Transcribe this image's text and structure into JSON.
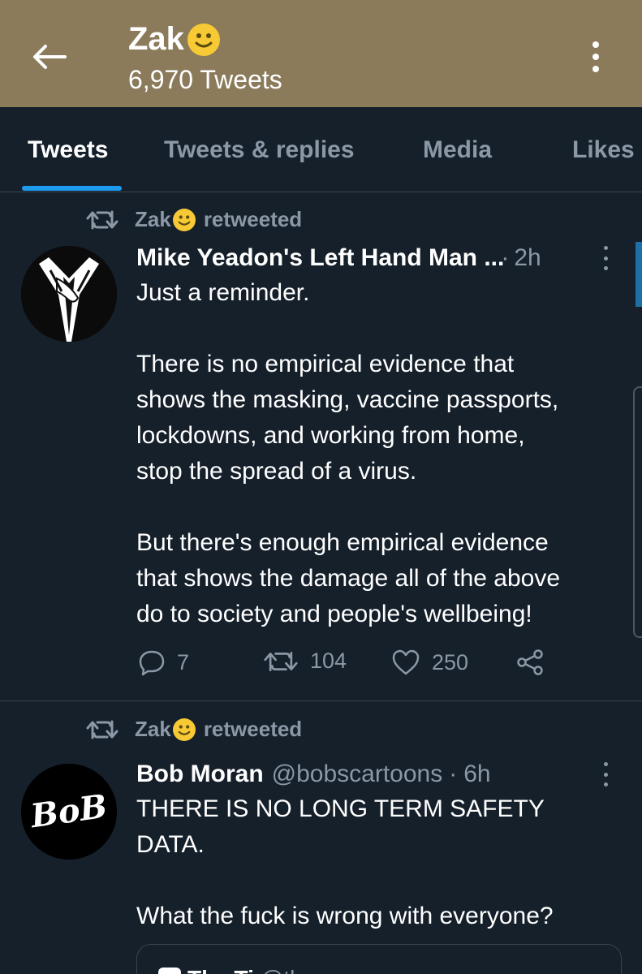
{
  "header": {
    "profile_name": "Zak",
    "tweet_count": "6,970 Tweets",
    "background": "#8b7b5b"
  },
  "tabs": [
    {
      "label": "Tweets",
      "active": true
    },
    {
      "label": "Tweets & replies",
      "active": false
    },
    {
      "label": "Media",
      "active": false
    },
    {
      "label": "Likes",
      "active": false
    }
  ],
  "colors": {
    "background": "#15202b",
    "accent": "#1d9bf0",
    "secondary_text": "#8b98a5",
    "divider": "#38444d"
  },
  "tweets": [
    {
      "retweeted_by": "Zak",
      "retweet_label": "retweeted",
      "author_name": "Mike Yeadon's Left Hand Man ...",
      "dot": "·",
      "time": "2h",
      "text": [
        "Just a reminder.",
        "",
        "There is no empirical evidence that",
        "shows the masking, vaccine passports,",
        "lockdowns, and working from home,",
        "stop the spread of a virus.",
        "",
        "But there's enough empirical evidence",
        "that shows the damage all of the above",
        "do to society and people's wellbeing!"
      ],
      "replies": "7",
      "retweets": "104",
      "likes": "250"
    },
    {
      "retweeted_by": "Zak",
      "retweet_label": "retweeted",
      "author_name": "Bob Moran",
      "author_handle": "@bobscartoons",
      "dot": "·",
      "time": "6h",
      "avatar_text": "BoB",
      "text": [
        "THERE IS NO LONG TERM SAFETY",
        "DATA.",
        "",
        "What the fuck is wrong with everyone?"
      ],
      "quote": {
        "name": "The Ti",
        "meta": "@th..."
      }
    }
  ]
}
